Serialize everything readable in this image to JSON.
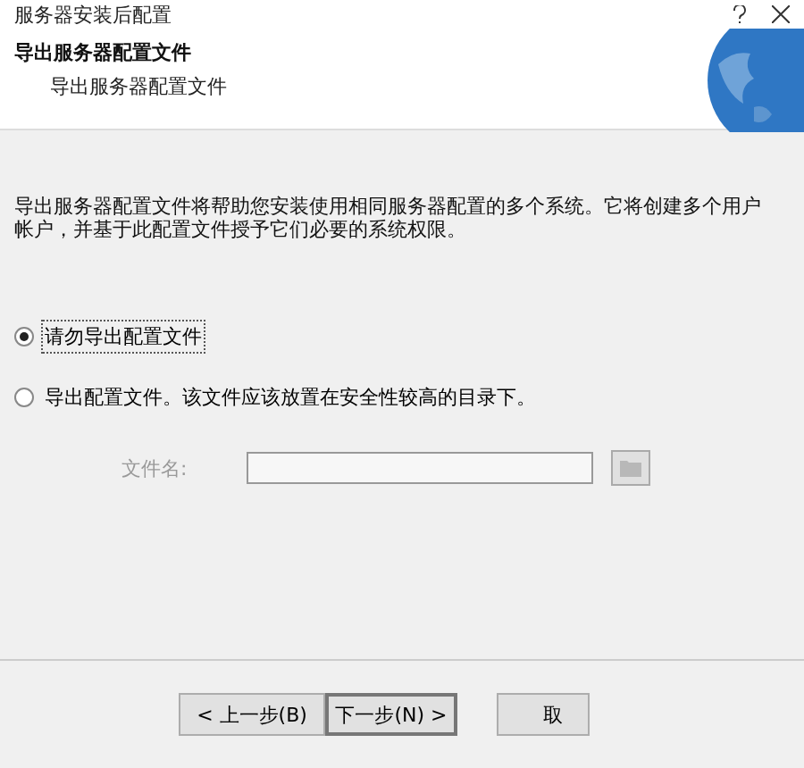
{
  "window": {
    "title": "服务器安装后配置"
  },
  "header": {
    "title": "导出服务器配置文件",
    "subtitle": "导出服务器配置文件"
  },
  "description": "导出服务器配置文件将帮助您安装使用相同服务器配置的多个系统。它将创建多个用户帐户，并基于此配置文件授予它们必要的系统权限。",
  "options": [
    {
      "label": "请勿导出配置文件",
      "selected": true
    },
    {
      "label": "导出配置文件。该文件应该放置在安全性较高的目录下。",
      "selected": false
    }
  ],
  "file_name": {
    "label": "文件名:",
    "disabled": true
  },
  "buttons": [
    {
      "label": "< 上一步(B)",
      "default": false
    },
    {
      "label": "下一步(N) >",
      "default": true
    },
    {
      "label": "取",
      "default": false
    }
  ]
}
